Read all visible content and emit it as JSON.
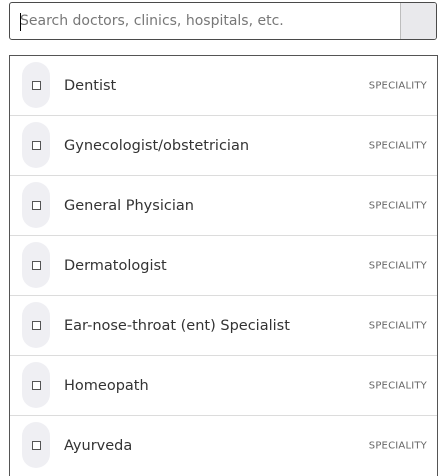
{
  "search": {
    "placeholder": "Search doctors, clinics, hospitals, etc."
  },
  "results": [
    {
      "label": "Dentist",
      "type": "SPECIALITY"
    },
    {
      "label": "Gynecologist/obstetrician",
      "type": "SPECIALITY"
    },
    {
      "label": "General Physician",
      "type": "SPECIALITY"
    },
    {
      "label": "Dermatologist",
      "type": "SPECIALITY"
    },
    {
      "label": "Ear-nose-throat (ent) Specialist",
      "type": "SPECIALITY"
    },
    {
      "label": "Homeopath",
      "type": "SPECIALITY"
    },
    {
      "label": "Ayurveda",
      "type": "SPECIALITY"
    }
  ],
  "colors": {
    "border": "#4a4a4a",
    "pill": "#efeff3",
    "text": "#333333",
    "muted": "#666666"
  }
}
